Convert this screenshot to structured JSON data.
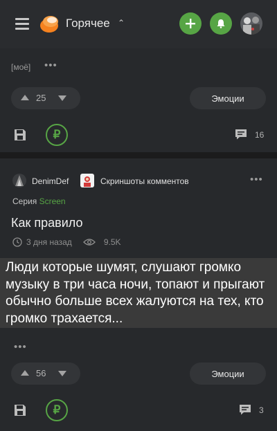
{
  "header": {
    "feed_title": "Горячее",
    "chevron": "⌃",
    "icons": [
      "menu-icon",
      "pikabu-logo-icon",
      "plus-icon",
      "bell-icon",
      "avatar"
    ],
    "accent_color": "#57a545"
  },
  "posts": [
    {
      "tag": "[моё]",
      "dots": "•••",
      "rating": "25",
      "emotions_label": "Эмоции",
      "donate_symbol": "₽",
      "comments_count": "16"
    },
    {
      "author": "DenimDef",
      "community": "Скриншоты комментов",
      "more": "•••",
      "series_label": "Серия",
      "series_name": "Screen",
      "title": "Как правило",
      "time": "3 дня назад",
      "views": "9.5K",
      "image_text": "Люди которые шумят, слушают громко музыку в три часа ночи, топают и прыгают обычно больше всех жалуются на тех, кто громко трахается...",
      "dots": "•••",
      "rating": "56",
      "emotions_label": "Эмоции",
      "donate_symbol": "₽",
      "comments_count": "3"
    }
  ]
}
